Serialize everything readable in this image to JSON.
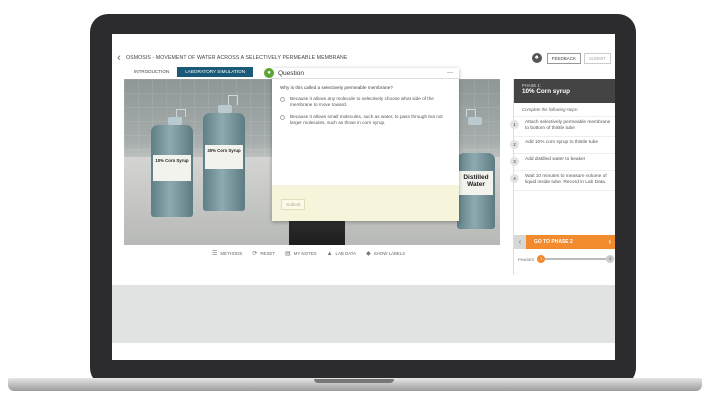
{
  "header": {
    "back_icon": "chevron-left-icon",
    "title": "OSMOSIS - MOVEMENT OF WATER ACROSS A SELECTIVELY PERMEABLE MEMBRANE",
    "feedback_label": "FEEDBACK",
    "submit_label": "SUBMIT",
    "accessibility_icon": "accessibility-icon"
  },
  "tabs": [
    {
      "label": "INTRODUCTION"
    },
    {
      "label": "LABORATORY SIMULATION"
    }
  ],
  "scene": {
    "bottles": [
      {
        "label": "10% Corn Syrup"
      },
      {
        "label": "30% Corn Syrup"
      },
      {
        "label": "Distilled Water"
      }
    ]
  },
  "question": {
    "title": "Question",
    "prompt": "Why is this called a selectively permeable membrane?",
    "options": [
      "Because it allows any molecule to selectively choose what side of the membrane to move toward.",
      "Because it allows small molecules, such as water, to pass through but not larger molecules, such as those in corn syrup."
    ],
    "submit_label": "Submit"
  },
  "toolbar": [
    {
      "icon": "methods-icon",
      "label": "METHODS"
    },
    {
      "icon": "reset-icon",
      "label": "RESET"
    },
    {
      "icon": "notes-icon",
      "label": "MY NOTES"
    },
    {
      "icon": "lab-data-icon",
      "label": "LAB DATA"
    },
    {
      "icon": "tag-icon",
      "label": "SHOW LABELS"
    }
  ],
  "side_panel": {
    "phase_label": "PHASE 1:",
    "phase_name": "10% Corn syrup",
    "subtitle": "Complete the following steps:",
    "steps": [
      {
        "num": "1",
        "text": "Attach selectively permeable membrane to bottom of thistle tube"
      },
      {
        "num": "2",
        "text": "Add 10% corn syrup to thistle tube"
      },
      {
        "num": "3",
        "text": "Add distilled water to beaker"
      },
      {
        "num": "4",
        "text": "Wait 10 minutes to measure volume of liquid inside tube. Record in Lab Data."
      }
    ],
    "goto_label": "GO TO PHASE 2",
    "progress_label": "PHASES",
    "progress_start": "1",
    "progress_end": "3"
  }
}
